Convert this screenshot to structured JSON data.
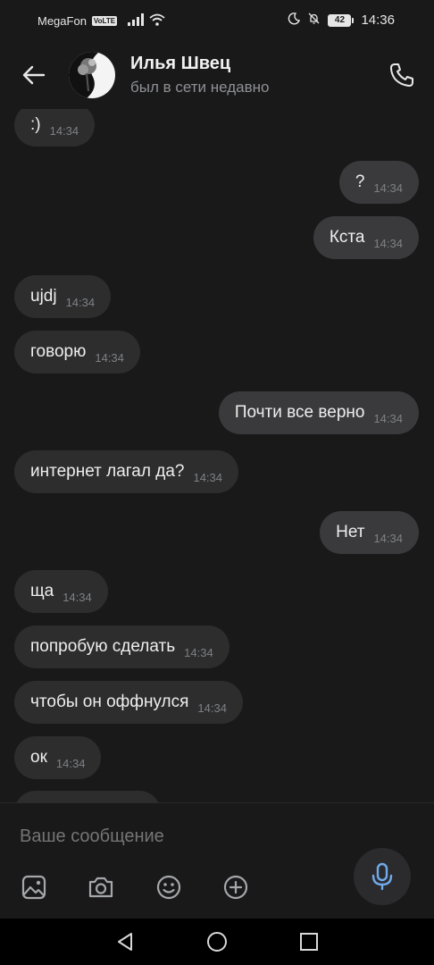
{
  "status_bar": {
    "carrier": "MegaFon",
    "volte": "VoLTE",
    "battery": "42",
    "time": "14:36"
  },
  "header": {
    "name": "Илья Швец",
    "status": "был в сети недавно"
  },
  "messages": [
    {
      "dir": "in",
      "text": ":)",
      "time": "14:34"
    },
    {
      "dir": "out",
      "text": "?",
      "time": "14:34"
    },
    {
      "dir": "out",
      "text": "Кста",
      "time": "14:34"
    },
    {
      "dir": "in",
      "text": "ujdj",
      "time": "14:34"
    },
    {
      "dir": "in",
      "text": "говорю",
      "time": "14:34"
    },
    {
      "dir": "out",
      "text": "Почти все верно",
      "time": "14:34"
    },
    {
      "dir": "in",
      "text": "интернет лагал да?",
      "time": "14:34"
    },
    {
      "dir": "out",
      "text": "Нет",
      "time": "14:34"
    },
    {
      "dir": "in",
      "text": "ща",
      "time": "14:34"
    },
    {
      "dir": "in",
      "text": "попробую сделать",
      "time": "14:34"
    },
    {
      "dir": "in",
      "text": "чтобы он оффнулся",
      "time": "14:34"
    },
    {
      "dir": "in",
      "text": "ок",
      "time": "14:34"
    }
  ],
  "composer": {
    "placeholder": "Ваше сообщение"
  },
  "icons": {
    "back": "arrow-left-icon",
    "call": "phone-icon",
    "gallery": "image-icon",
    "camera": "camera-icon",
    "emoji": "smile-icon",
    "attach": "plus-circle-icon",
    "mic": "microphone-icon"
  },
  "colors": {
    "background": "#19191a",
    "bubble_in": "#2d2d2e",
    "bubble_out": "#3a3a3c",
    "mic_accent": "#71aaeb"
  }
}
